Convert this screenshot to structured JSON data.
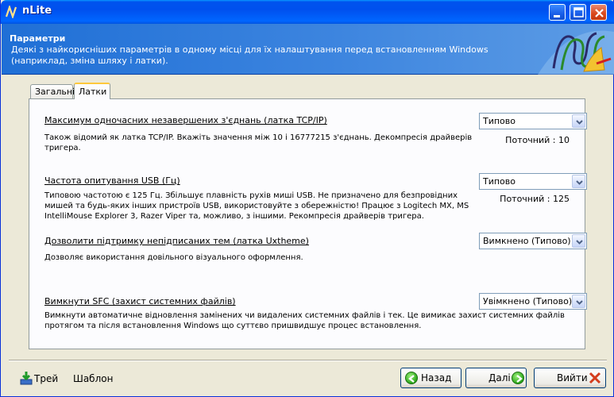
{
  "window": {
    "title": "nLite"
  },
  "header": {
    "title": "Параметри",
    "description": "Деякі з найкорисніших параметрів в одному місці для їх налаштування перед встановленням Windows (наприклад, зміна шляху і латки)."
  },
  "tabs": [
    {
      "label": "Загальні",
      "active": false
    },
    {
      "label": "Латки",
      "active": true
    }
  ],
  "settings": [
    {
      "title": "Максимум одночасних незавершених з'єднань (латка TCP/IP)",
      "description": "Також відомий як латка TCP/IP. Вкажіть значення між 10 і 16777215 з'єднань. Декомпресія драйверів тригера.",
      "value": "Типово",
      "current": "Поточний : 10"
    },
    {
      "title": "Частота опитування USB (Гц)",
      "description": "Типовою частотою є 125 Гц. Збільшує плавність рухів миші USB. Не призначено для безпровідних мишей та будь-яких інших пристроїв USB, використовуйте з обережністю! Працює з Logitech MX, MS IntelliMouse Explorer 3, Razer Viper та, можливо, з іншими. Рекомпресія драйверів тригера.",
      "value": "Типово",
      "current": "Поточний : 125"
    },
    {
      "title": "Дозволити підтримку непідписаних тем (латка Uxtheme)",
      "description": "Дозволяє використання довільного візуального оформлення.",
      "value": "Вимкнено (Типово)",
      "current": ""
    },
    {
      "title": "Вимкнути SFC (захист системних файлів)",
      "description": "Вимкнути автоматичне відновлення замінених чи видалених системних файлів і тек. Це вимикає захист системних файлів протягом та після встановлення Windows що суттєво пришвидшує процес встановлення.",
      "value": "Увімкнено (Типово)",
      "current": ""
    }
  ],
  "footer": {
    "tray_label": "Трей",
    "template_label": "Шаблон",
    "back_label": "Назад",
    "next_label": "Далі",
    "exit_label": "Вийти"
  },
  "icons": {
    "app": "nlite-logo-icon",
    "tray": "tray-download-icon",
    "back": "back-arrow-icon",
    "next": "next-arrow-icon",
    "exit": "close-x-icon"
  },
  "colors": {
    "titlebar": "#0053ee",
    "header": "#3d85df",
    "tab_highlight": "#ffc83c",
    "exit_x": "#d43c1c",
    "nav_green": "#2aa61a"
  }
}
